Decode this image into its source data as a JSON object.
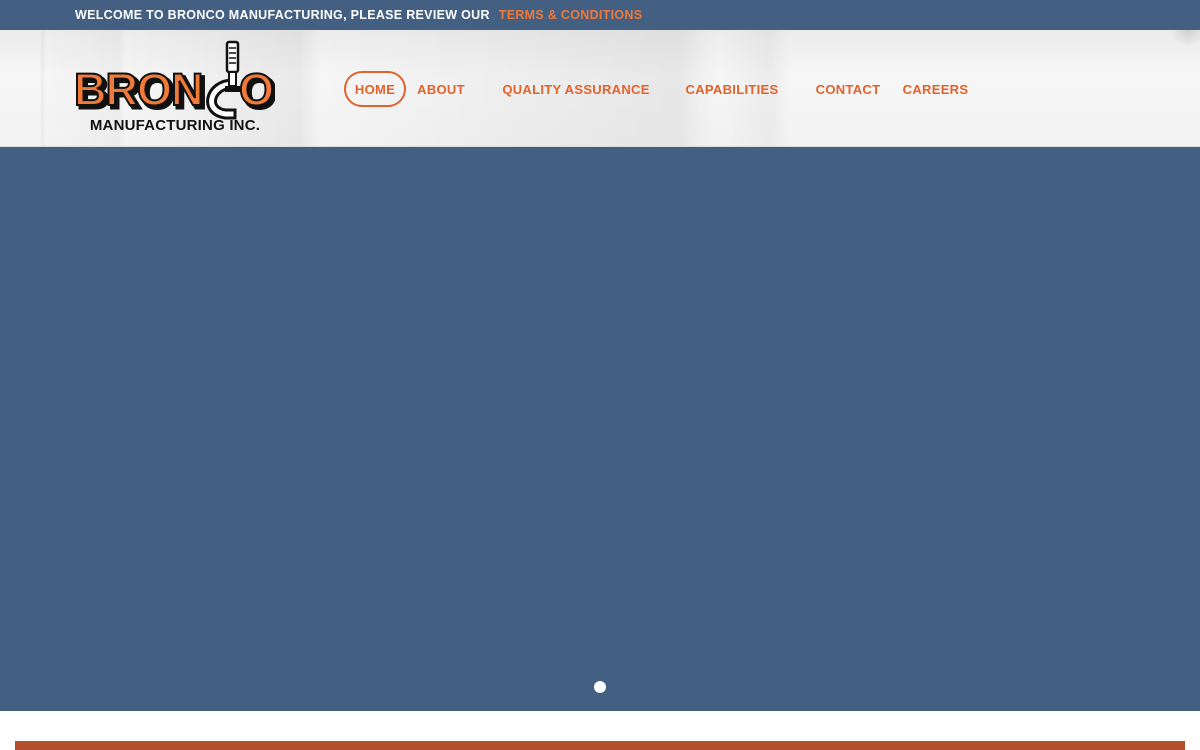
{
  "topbar": {
    "message": "WELCOME TO BRONCO MANUFACTURING, PLEASE REVIEW OUR",
    "link_label": "TERMS & CONDITIONS"
  },
  "logo": {
    "word_left": "BRON",
    "word_right": "O",
    "subtitle": "MANUFACTURING INC.",
    "icon": "micrometer-c-icon"
  },
  "nav": {
    "items": [
      {
        "label": "HOME",
        "active": true
      },
      {
        "label": "ABOUT",
        "active": false
      },
      {
        "label": "QUALITY ASSURANCE",
        "active": false
      },
      {
        "label": "CAPABILITIES",
        "active": false
      },
      {
        "label": "CONTACT",
        "active": false
      },
      {
        "label": "CAREERS",
        "active": false
      }
    ]
  },
  "hero": {
    "slides_total": 1,
    "active_slide": 1
  },
  "colors": {
    "brand_orange": "#e2622b",
    "brand_blue": "#435f82",
    "strip_red": "#b3502b"
  }
}
